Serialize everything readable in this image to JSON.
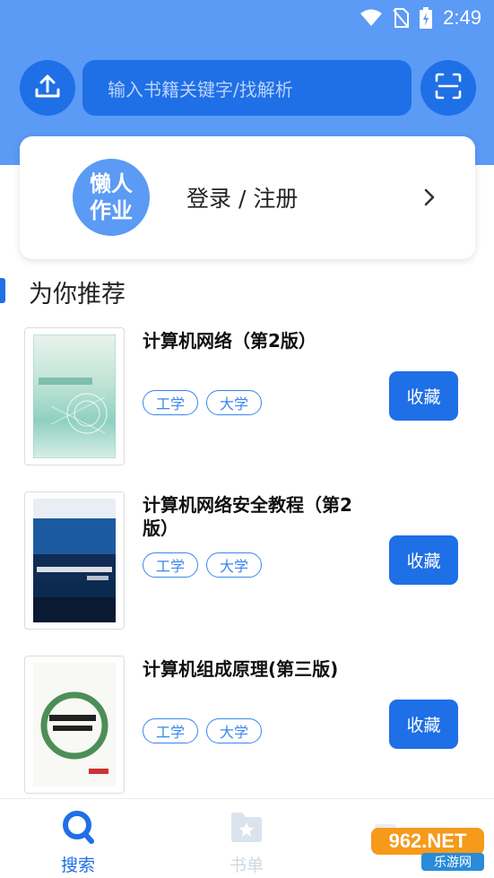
{
  "status_bar": {
    "time": "2:49",
    "icons": [
      "wifi-icon",
      "no-sim-icon",
      "battery-charging-icon"
    ]
  },
  "search": {
    "placeholder": "输入书籍关键字/找解析",
    "upload_icon": "upload-icon",
    "scan_icon": "scan-icon"
  },
  "login_card": {
    "logo_line1": "懒人",
    "logo_line2": "作业",
    "label": "登录 / 注册"
  },
  "section": {
    "title": "为你推荐"
  },
  "books": [
    {
      "title": "计算机网络（第2版）",
      "tags": [
        "工学",
        "大学"
      ],
      "button": "收藏"
    },
    {
      "title": "计算机网络安全教程（第2版）",
      "tags": [
        "工学",
        "大学"
      ],
      "button": "收藏"
    },
    {
      "title": "计算机组成原理(第三版)",
      "tags": [
        "工学",
        "大学"
      ],
      "button": "收藏"
    }
  ],
  "bottom_nav": {
    "items": [
      {
        "label": "搜索",
        "icon": "search-icon",
        "active": true
      },
      {
        "label": "书单",
        "icon": "folder-star-icon",
        "active": false
      }
    ]
  },
  "watermark": {
    "main": "962.NET",
    "sub": "乐游网"
  },
  "colors": {
    "primary": "#1f6fe6",
    "header_bg": "#5b9af5",
    "inactive_nav": "#cfd8e6"
  }
}
